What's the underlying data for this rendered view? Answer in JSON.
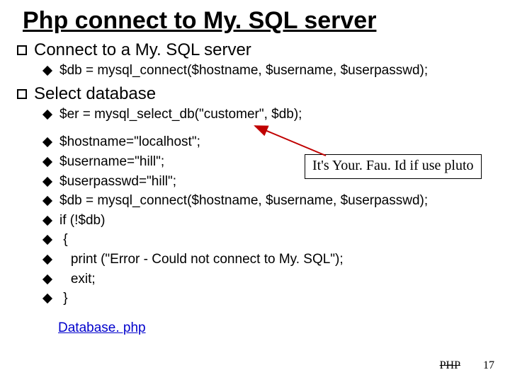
{
  "title": "Php connect to My. SQL server",
  "sections": [
    {
      "heading": "Connect to a My. SQL server",
      "items": [
        "$db = mysql_connect($hostname, $username, $userpasswd);"
      ]
    },
    {
      "heading": "Select database",
      "items": [
        "$er = mysql_select_db(\"customer\", $db);"
      ]
    }
  ],
  "code_block": [
    "$hostname=\"localhost\";",
    "$username=\"hill\";",
    "$userpasswd=\"hill\";",
    "$db = mysql_connect($hostname, $username, $userpasswd);",
    "if (!$db)",
    " {",
    "   print (\"Error - Could not connect to My. SQL\");",
    "   exit;",
    " }"
  ],
  "callout": "It's Your. Fau. Id if use pluto",
  "link": "Database. php",
  "footer": {
    "label": "PHP",
    "page": "17"
  }
}
